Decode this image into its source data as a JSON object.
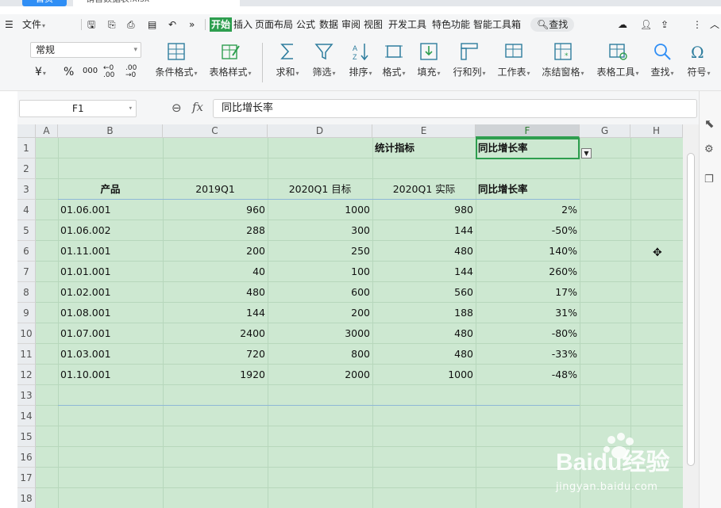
{
  "app": {
    "home_tab": "首页",
    "file_tab": "销售数据表.xlsx"
  },
  "menu": {
    "file": "文件",
    "items": [
      "开始",
      "插入",
      "页面布局",
      "公式",
      "数据",
      "审阅",
      "视图",
      "开发工具",
      "特色功能",
      "智能工具箱"
    ],
    "active_index": 0,
    "search": "查找"
  },
  "toolbar": {
    "number_format": "常规",
    "currency_symbol": "¥",
    "percent_symbol": "%",
    "thousands_symbol": "000",
    "inc_decimal": "←0 .00",
    "dec_decimal": ".00 →0",
    "buttons": [
      {
        "label": "条件格式",
        "icon": "conditional-format-icon"
      },
      {
        "label": "表格样式",
        "icon": "table-style-icon"
      },
      {
        "label": "求和",
        "icon": "sum-icon"
      },
      {
        "label": "筛选",
        "icon": "filter-icon"
      },
      {
        "label": "排序",
        "icon": "sort-icon"
      },
      {
        "label": "格式",
        "icon": "format-icon"
      },
      {
        "label": "填充",
        "icon": "fill-icon"
      },
      {
        "label": "行和列",
        "icon": "row-col-icon"
      },
      {
        "label": "工作表",
        "icon": "worksheet-icon"
      },
      {
        "label": "冻结窗格",
        "icon": "freeze-panes-icon"
      },
      {
        "label": "表格工具",
        "icon": "table-tools-icon"
      },
      {
        "label": "查找",
        "icon": "find-icon"
      },
      {
        "label": "符号",
        "icon": "symbol-icon"
      }
    ]
  },
  "formula_bar": {
    "cell_ref": "F1",
    "fx": "fx",
    "content": "同比增长率"
  },
  "sheet": {
    "columns": [
      "A",
      "B",
      "C",
      "D",
      "E",
      "F",
      "G",
      "H"
    ],
    "selected_column": "F",
    "rows": [
      "1",
      "2",
      "3",
      "4",
      "5",
      "6",
      "7",
      "8",
      "9",
      "10",
      "11",
      "12",
      "13",
      "14",
      "15",
      "16",
      "17",
      "18"
    ],
    "stat_label": "统计指标",
    "stat_value": "同比增长率",
    "headers": [
      "产品",
      "2019Q1",
      "2020Q1 目标",
      "2020Q1 实际",
      "同比增长率"
    ],
    "data": [
      [
        "01.06.001",
        "960",
        "1000",
        "980",
        "2%"
      ],
      [
        "01.06.002",
        "288",
        "300",
        "144",
        "-50%"
      ],
      [
        "01.11.001",
        "200",
        "250",
        "480",
        "140%"
      ],
      [
        "01.01.001",
        "40",
        "100",
        "144",
        "260%"
      ],
      [
        "01.02.001",
        "480",
        "600",
        "560",
        "17%"
      ],
      [
        "01.08.001",
        "144",
        "200",
        "188",
        "31%"
      ],
      [
        "01.07.001",
        "2400",
        "3000",
        "480",
        "-80%"
      ],
      [
        "01.03.001",
        "720",
        "800",
        "480",
        "-33%"
      ],
      [
        "01.10.001",
        "1920",
        "2000",
        "1000",
        "-48%"
      ]
    ]
  },
  "watermark": {
    "brand": "Baidu经验",
    "url": "jingyan.baidu.com"
  },
  "colors": {
    "accent": "#2e9e4f",
    "grid_bg": "#cde8d1",
    "table_border": "#8fb8d6"
  }
}
